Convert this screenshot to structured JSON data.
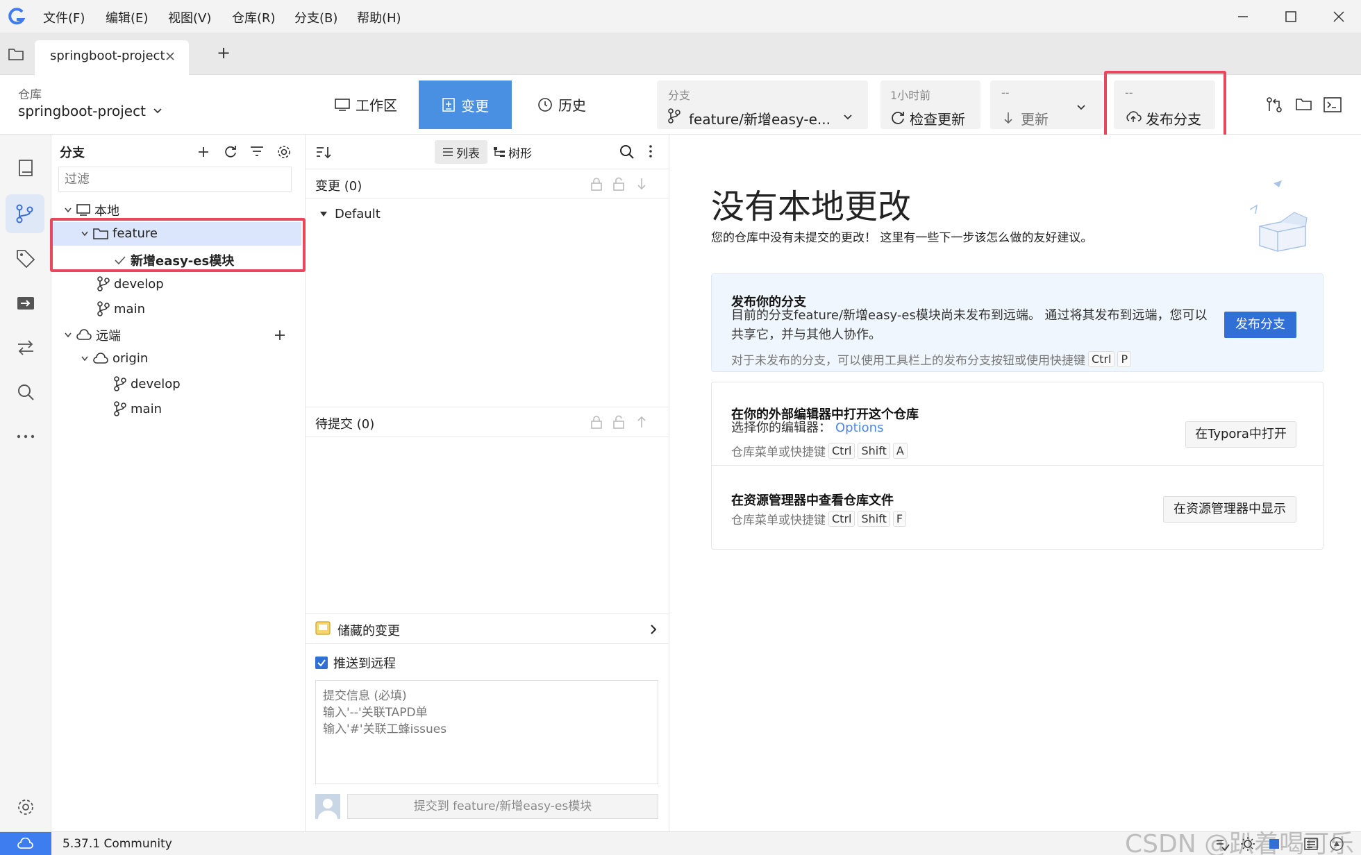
{
  "app": {
    "menu": [
      "文件(F)",
      "编辑(E)",
      "视图(V)",
      "仓库(R)",
      "分支(B)",
      "帮助(H)"
    ]
  },
  "tabs": {
    "active": "springboot-project",
    "add": "+"
  },
  "toolbar": {
    "repo_label": "仓库",
    "repo_name": "springboot-project",
    "workspace": "工作区",
    "changes": "变更",
    "history": "历史",
    "branch_label": "分支",
    "branch_value": "feature/新增easy-e...",
    "fetch_time": "1小时前",
    "fetch_label": "检查更新",
    "pull_top": "--",
    "pull_label": "更新",
    "publish_top": "--",
    "publish_label": "发布分支"
  },
  "branches": {
    "title": "分支",
    "filter_placeholder": "过滤",
    "local": "本地",
    "folder": "feature",
    "current": "新增easy-es模块",
    "develop": "develop",
    "main": "main",
    "remote": "远端",
    "origin": "origin",
    "remote_develop": "develop",
    "remote_main": "main"
  },
  "changes": {
    "list": "列表",
    "tree": "树形",
    "unstaged": "变更 (0)",
    "default_group": "Default",
    "staged": "待提交 (0)",
    "stash": "储藏的变更",
    "push_remote": "推送到远程",
    "commit_placeholder": "提交信息 (必填)\n输入'--'关联TAPD单\n输入'#'关联工蜂issues",
    "commit_button": "提交到 feature/新增easy-es模块"
  },
  "main": {
    "heading": "没有本地更改",
    "subheading": "您的仓库中没有未提交的更改！ 这里有一些下一步该怎么做的友好建议。",
    "publish": {
      "title": "发布你的分支",
      "line1": "目前的分支feature/新增easy-es模块尚未发布到远端。 通过将其发布到远端，您可以",
      "line2": "共享它，并与其他人协作。",
      "hint": "对于未发布的分支，可以使用工具栏上的发布分支按钮或使用快捷键",
      "keys": [
        "Ctrl",
        "P"
      ],
      "button": "发布分支"
    },
    "editor": {
      "title": "在你的外部编辑器中打开这个仓库",
      "line1": "选择你的编辑器：",
      "options": "Options",
      "hint": "仓库菜单或快捷键",
      "keys": [
        "Ctrl",
        "Shift",
        "A"
      ],
      "button": "在Typora中打开"
    },
    "explorer": {
      "title": "在资源管理器中查看仓库文件",
      "hint": "仓库菜单或快捷键",
      "keys": [
        "Ctrl",
        "Shift",
        "F"
      ],
      "button": "在资源管理器中显示"
    }
  },
  "status": {
    "version": "5.37.1 Community",
    "watermark": "CSDN @趴着喝可乐"
  },
  "colors": {
    "accent": "#4a90e2",
    "primary_button": "#2f6fd6",
    "highlight": "#e8485e"
  }
}
